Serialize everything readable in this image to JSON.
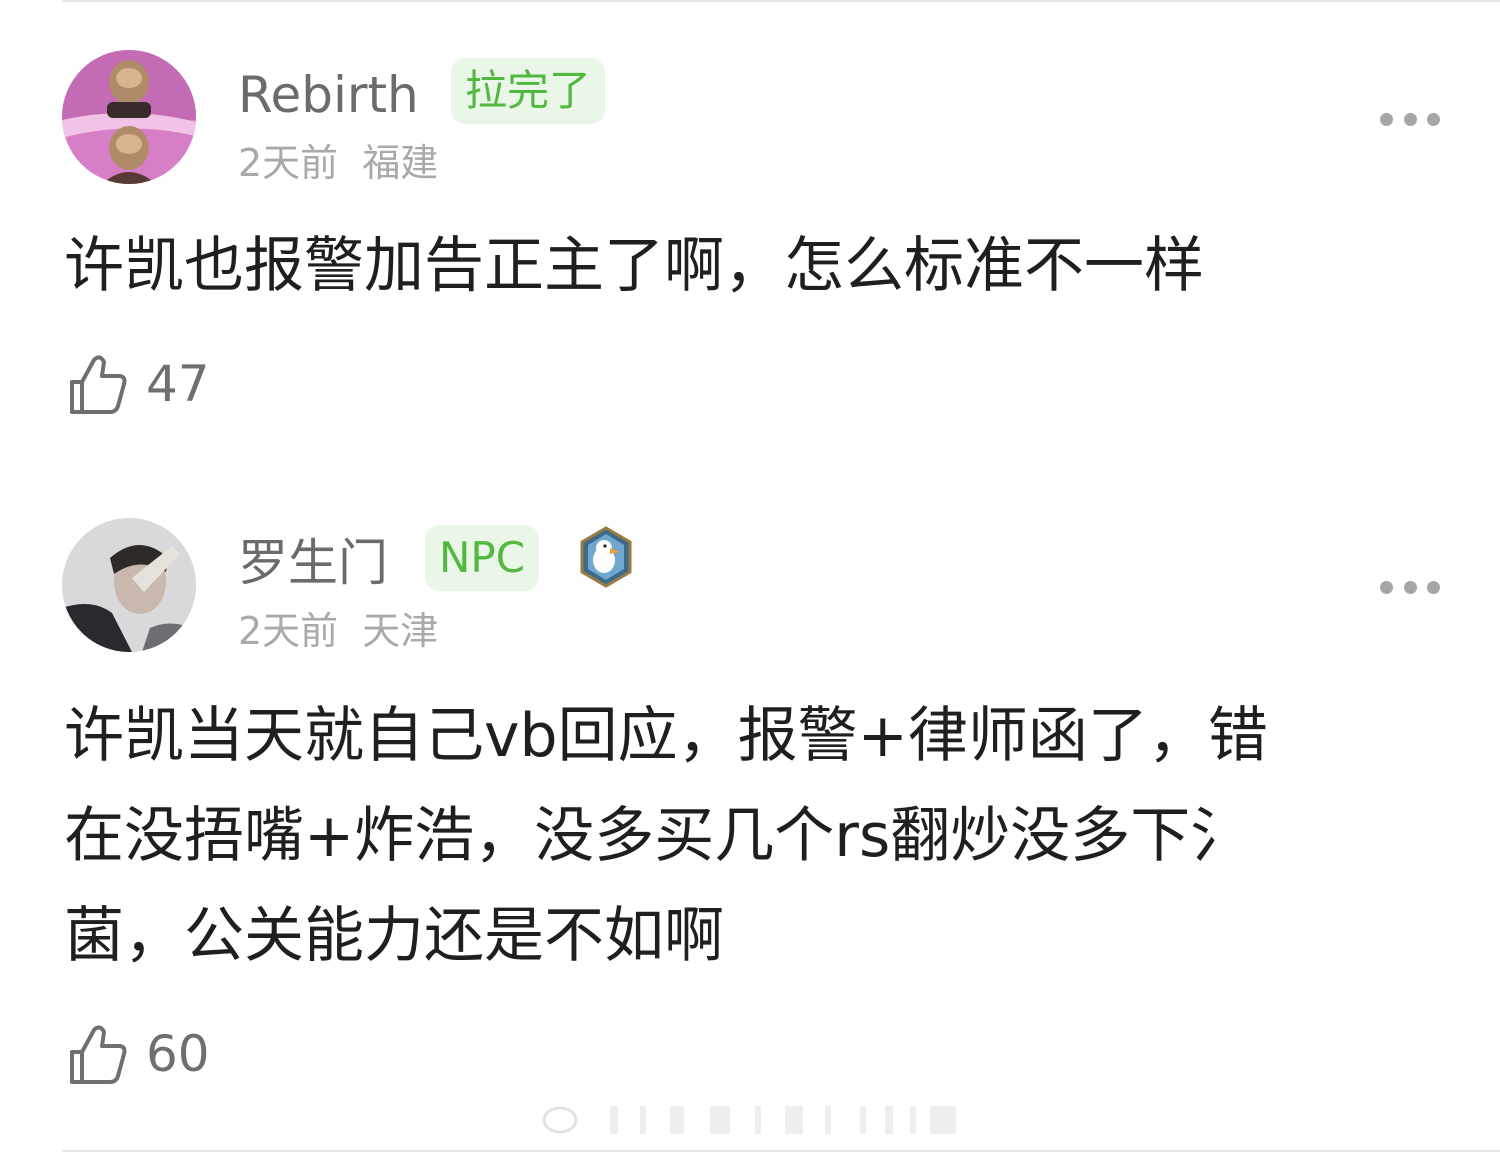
{
  "comments": [
    {
      "username": "Rebirth",
      "tag": "拉完了",
      "time": "2天前",
      "location": "福建",
      "content_lines": [
        "许凯也报警加告正主了啊，怎么标准不一样"
      ],
      "likes": "47",
      "avatar_icon": "avatar-pink-cartoon",
      "more_icon": "more-dots-icon"
    },
    {
      "username": "罗生门",
      "tag": "NPC",
      "time": "2天前",
      "location": "天津",
      "content_lines": [
        "许凯当天就自己vb回应，报警+律师函了，错",
        "在没捂嘴+炸浩，没多买几个rs翻炒没多下氵",
        "菌，公关能力还是不如啊"
      ],
      "likes": "60",
      "avatar_icon": "avatar-photo-person",
      "badge_icon": "duck-badge-icon",
      "more_icon": "more-dots-icon"
    }
  ],
  "colors": {
    "tag_bg": "#e9f6e8",
    "tag_text": "#53b83f",
    "username": "#6b6b6b",
    "meta": "#a9a9a9"
  }
}
